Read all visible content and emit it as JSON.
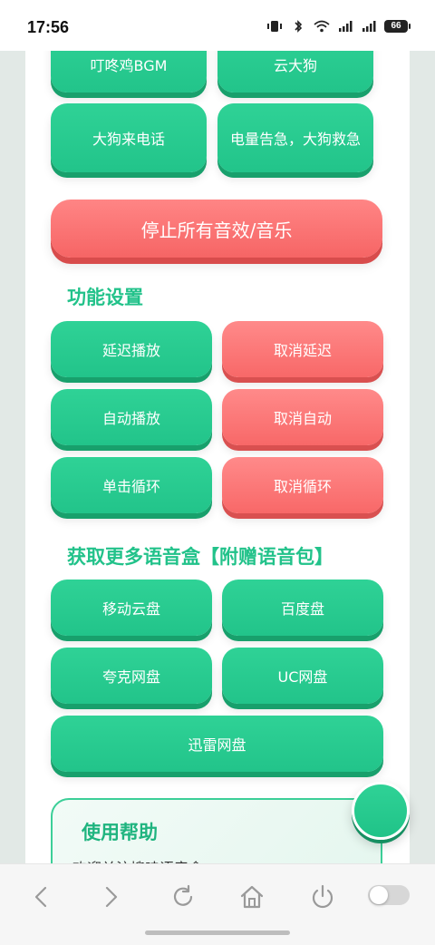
{
  "status": {
    "time": "17:56",
    "battery": "66",
    "icons": [
      "vibrate-icon",
      "bluetooth-icon",
      "wifi-icon",
      "signal-5g-icon",
      "signal-5g-icon",
      "battery-icon"
    ]
  },
  "sound_buttons": {
    "top_partial": [
      "叮咚鸡BGM",
      "云大狗"
    ],
    "row2": [
      "大狗来电话",
      "电量告急，大狗救急"
    ],
    "stop_all": "停止所有音效/音乐"
  },
  "settings": {
    "title": "功能设置",
    "rows": [
      {
        "left": "延迟播放",
        "right": "取消延迟"
      },
      {
        "left": "自动播放",
        "right": "取消自动"
      },
      {
        "left": "单击循环",
        "right": "取消循环"
      }
    ]
  },
  "more": {
    "title": "获取更多语音盒【附赠语音包】",
    "rows": [
      {
        "left": "移动云盘",
        "right": "百度盘"
      },
      {
        "left": "夸克网盘",
        "right": "UC网盘"
      }
    ],
    "wide": "迅雷网盘"
  },
  "help": {
    "title": "使用帮助",
    "text": "欢迎关注搜哇语音盒"
  },
  "colors": {
    "green": "#22c48a",
    "red": "#f86868",
    "title_green": "#22c28a"
  },
  "bottom_nav": [
    "back-icon",
    "forward-icon",
    "refresh-icon",
    "home-icon",
    "power-icon",
    "toggle-switch"
  ]
}
